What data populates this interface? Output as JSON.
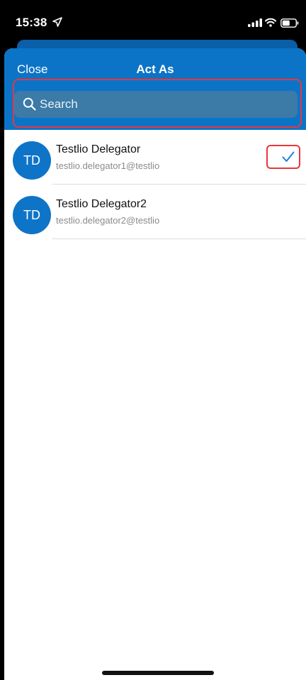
{
  "status_bar": {
    "time": "15:38",
    "icons": [
      "location-arrow-icon",
      "signal-icon",
      "wifi-icon",
      "battery-icon"
    ]
  },
  "header": {
    "close_label": "Close",
    "title": "Act As"
  },
  "search": {
    "placeholder": "Search"
  },
  "delegates": [
    {
      "initials": "TD",
      "name": "Testlio Delegator",
      "email": "testlio.delegator1@testlio",
      "selected": true
    },
    {
      "initials": "TD",
      "name": "Testlio Delegator2",
      "email": "testlio.delegator2@testlio",
      "selected": false
    }
  ],
  "colors": {
    "header_blue": "#0c74c6",
    "avatar_blue": "#0e74c8",
    "highlight_red": "#e8363f",
    "check_blue": "#1a7fe0"
  }
}
